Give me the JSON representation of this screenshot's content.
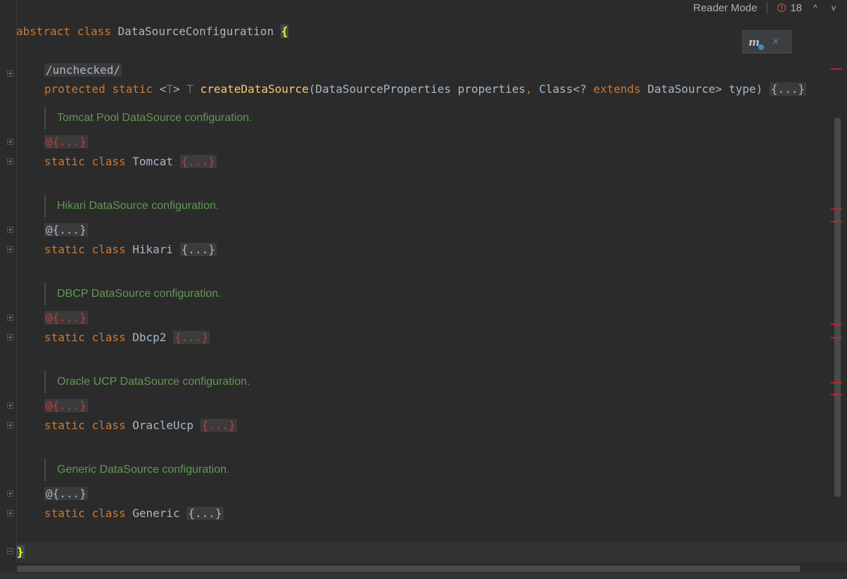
{
  "editor": {
    "class_decl": {
      "kw1": "abstract",
      "kw2": "class",
      "name": "DataSourceConfiguration",
      "brace": "{"
    },
    "unchecked_label": "/unchecked/",
    "method": {
      "kw1": "protected",
      "kw2": "static",
      "generic_open": "<",
      "generic_t": "T",
      "generic_close": ">",
      "ret": "T",
      "name": "createDataSource",
      "params_a": "(DataSourceProperties properties",
      "comma": ",",
      "params_b": " Class<? ",
      "extends": "extends",
      "params_c": " DataSource> type) ",
      "folded": "{...}"
    },
    "sections": [
      {
        "doc": "Tomcat Pool DataSource configuration.",
        "annotation": "@{...}",
        "kw1": "static",
        "kw2": "class",
        "name": "Tomcat",
        "folded": "{...}"
      },
      {
        "doc": "Hikari DataSource configuration.",
        "annotation": "@{...}",
        "kw1": "static",
        "kw2": "class",
        "name": "Hikari",
        "folded": "{...}"
      },
      {
        "doc": "DBCP DataSource configuration.",
        "annotation": "@{...}",
        "kw1": "static",
        "kw2": "class",
        "name": "Dbcp2",
        "folded": "{...}"
      },
      {
        "doc": "Oracle UCP DataSource configuration.",
        "annotation": "@{...}",
        "kw1": "static",
        "kw2": "class",
        "name": "OracleUcp",
        "folded": "{...}"
      },
      {
        "doc": "Generic DataSource configuration.",
        "annotation": "@{...}",
        "kw1": "static",
        "kw2": "class",
        "name": "Generic",
        "folded": "{...}"
      }
    ],
    "closing_brace": "}"
  },
  "toolbar": {
    "reader_mode": "Reader Mode",
    "error_icon": "!",
    "error_count": "18",
    "prev_icon": "^",
    "next_icon": "v"
  },
  "floating": {
    "icon": "m",
    "close": "×"
  },
  "colors": {
    "keyword": "#cc7832",
    "method": "#ffc66d",
    "doc": "#629755",
    "error": "#bc3f3c",
    "background": "#2b2b2b"
  }
}
